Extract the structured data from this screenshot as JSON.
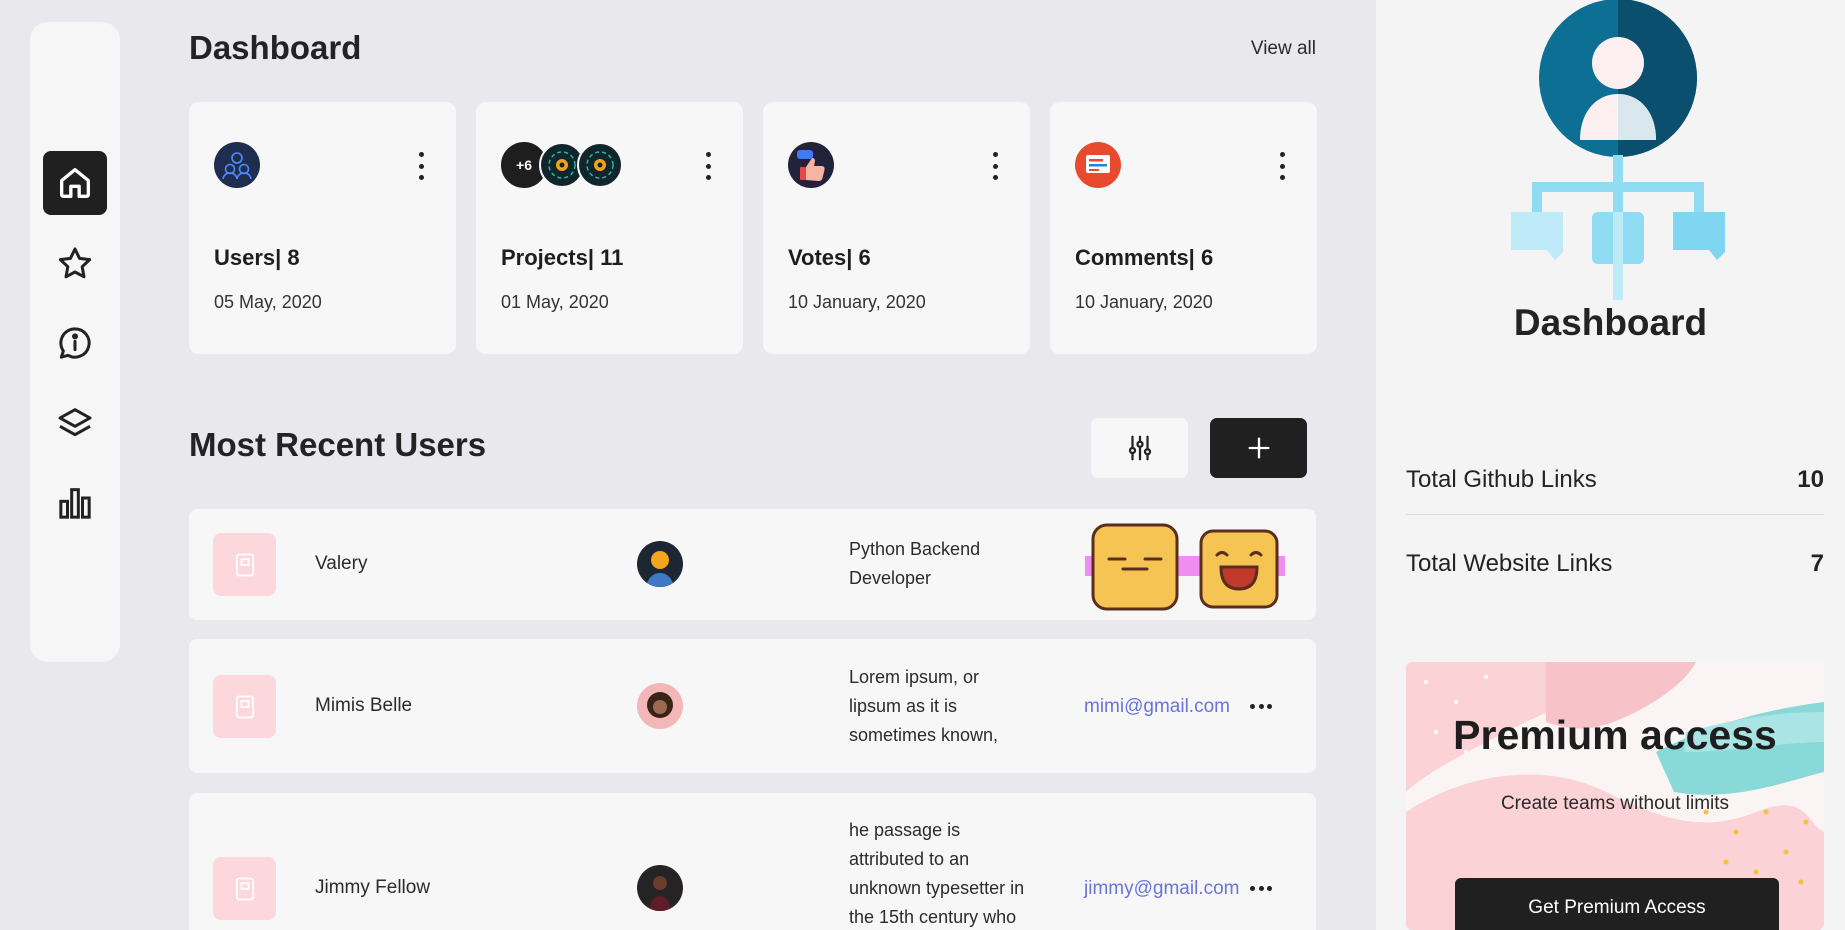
{
  "header": {
    "title": "Dashboard",
    "view_all": "View all"
  },
  "nav": {
    "items": [
      {
        "name": "home",
        "icon": "home-icon",
        "active": true
      },
      {
        "name": "favorites",
        "icon": "star-icon",
        "active": false
      },
      {
        "name": "info",
        "icon": "info-chat-icon",
        "active": false
      },
      {
        "name": "layers",
        "icon": "layers-icon",
        "active": false
      },
      {
        "name": "stats",
        "icon": "bar-chart-icon",
        "active": false
      }
    ]
  },
  "stats": [
    {
      "label": "Users| 8",
      "date": "05 May, 2020",
      "icon": "users-group-icon"
    },
    {
      "label": "Projects| 11",
      "date": "01 May, 2020",
      "icon": "project-avatars",
      "badge": "+6"
    },
    {
      "label": "Votes| 6",
      "date": "10 January, 2020",
      "icon": "thumbs-up-icon"
    },
    {
      "label": "Comments| 6",
      "date": "10 January, 2020",
      "icon": "comment-icon"
    }
  ],
  "recent": {
    "title": "Most Recent Users",
    "rows": [
      {
        "name": "Valery",
        "desc_lines": [
          "Python Backend",
          "Developer"
        ],
        "email": ""
      },
      {
        "name": "Mimis Belle",
        "desc_lines": [
          "Lorem ipsum, or",
          "lipsum as it is",
          "sometimes known,"
        ],
        "email": "mimi@gmail.com"
      },
      {
        "name": "Jimmy Fellow",
        "desc_lines": [
          "he passage is",
          "attributed to an",
          "unknown typesetter in",
          "the 15th century who"
        ],
        "email": "jimmy@gmail.com"
      }
    ]
  },
  "side": {
    "title": "Dashboard",
    "metrics": [
      {
        "label": "Total Github Links",
        "value": "10"
      },
      {
        "label": "Total Website Links",
        "value": "7"
      }
    ],
    "premium": {
      "title": "Premium access",
      "subtitle": "Create teams without limits",
      "button": "Get Premium Access"
    }
  },
  "colors": {
    "accent": "#202020",
    "thumb": "#fcd7dc",
    "link": "#6a74d8",
    "panel": "#f4f4f5",
    "bg": "#e9e8ec"
  }
}
